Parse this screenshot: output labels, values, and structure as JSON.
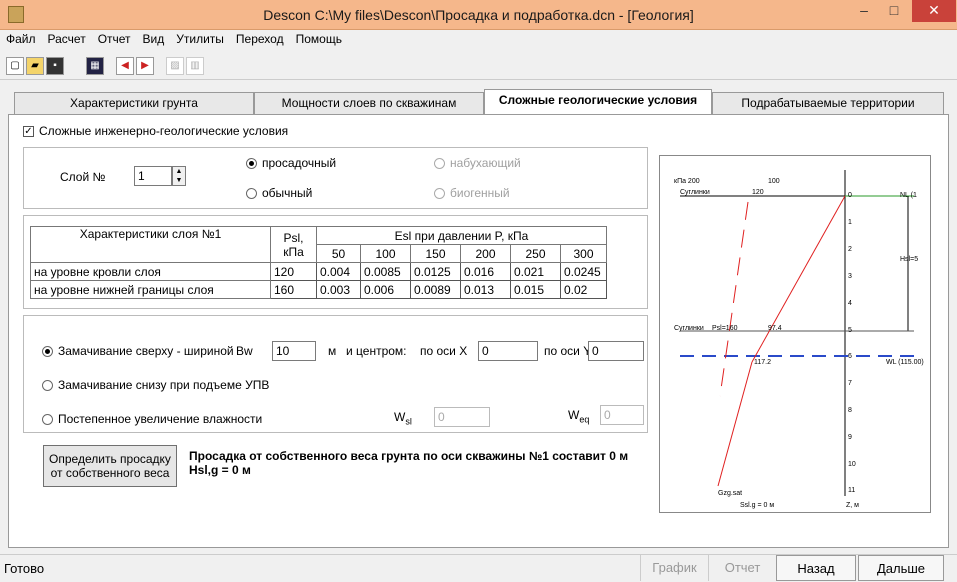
{
  "window": {
    "title": "Descon C:\\My files\\Descon\\Просадка и подработка.dcn - [Геология]",
    "minimize": "–",
    "maximize": "□",
    "close": "✕"
  },
  "menu": [
    "Файл",
    "Расчет",
    "Отчет",
    "Вид",
    "Утилиты",
    "Переход",
    "Помощь"
  ],
  "tabs": [
    {
      "label": "Характеристики грунта",
      "active": false
    },
    {
      "label": "Мощности слоев по скважинам",
      "active": false
    },
    {
      "label": "Сложные геологические условия",
      "active": true
    },
    {
      "label": "Подрабатываемые территории",
      "active": false
    }
  ],
  "complex_conditions": {
    "label": "Сложные инженерно-геологические условия",
    "checked": true,
    "mark": "✓"
  },
  "layer": {
    "label": "Слой №",
    "value": "1"
  },
  "soil_types": {
    "subsiding": "просадочный",
    "swelling": "набухающий",
    "ordinary": "обычный",
    "biogenic": "биогенный"
  },
  "table": {
    "title": "Характеристики слоя №1",
    "psl_header": "Psl, кПа",
    "esl_header": "Esl при давлении P, кПа",
    "pressures": [
      "50",
      "100",
      "150",
      "200",
      "250",
      "300"
    ],
    "rows": [
      {
        "label": "на уровне кровли слоя",
        "psl": "120",
        "values": [
          "0.004",
          "0.0085",
          "0.0125",
          "0.016",
          "0.021",
          "0.0245"
        ]
      },
      {
        "label": "на уровне нижней границы слоя",
        "psl": "160",
        "values": [
          "0.003",
          "0.006",
          "0.0089",
          "0.013",
          "0.015",
          "0.02"
        ]
      }
    ]
  },
  "wetting": {
    "top_label": "Замачивание сверху - шириной",
    "bw_label": "Bw",
    "bw_value": "10",
    "unit_m": "м",
    "center_label": "и центром:",
    "axis_x_label": "по оси X",
    "axis_x_value": "0",
    "axis_y_label": "по оси Y",
    "axis_y_value": "0",
    "bottom_label": "Замачивание снизу при подъеме УПВ",
    "gradual_label": "Постепенное увеличение влажности",
    "wsl_label": "W",
    "wsl_sub": "sl",
    "wsl_value": "0",
    "weq_label": "W",
    "weq_sub": "eq",
    "weq_value": "0"
  },
  "determine_button": "Определить просадку от собственного веса",
  "result_line1": "Просадка от собственного веса грунта по оси скважины №1 составит 0 м",
  "result_line2": "Hsl,g = 0 м",
  "chart": {
    "kpa_label": "кПа 200",
    "tick_100": "100",
    "soil_top": "Суглинки",
    "val_120": "120",
    "soil_bottom": "Суглинки",
    "psl_160": "Psl=160",
    "val_97": "97.4",
    "val_117": "117.2",
    "nl_label": "NL (1",
    "hsl_label": "Hsl=5",
    "wl_label": "WL (115.00)",
    "depth_ticks": [
      "0",
      "1",
      "2",
      "3",
      "4",
      "5",
      "6",
      "7",
      "8",
      "9",
      "10",
      "11"
    ],
    "gzg_label": "Gzg.sat",
    "ssl_label": "Ssl.g = 0 м",
    "z_label": "Z, м"
  },
  "status": {
    "text": "Готово",
    "graph": "График",
    "report": "Отчет",
    "back": "Назад",
    "next": "Дальше"
  },
  "colors": {
    "titlebar": "#f5b78b",
    "close": "#c9423a",
    "grid_line": "#2a9a2a",
    "water_line": "#2a4ac9",
    "curve": "#e02020"
  }
}
